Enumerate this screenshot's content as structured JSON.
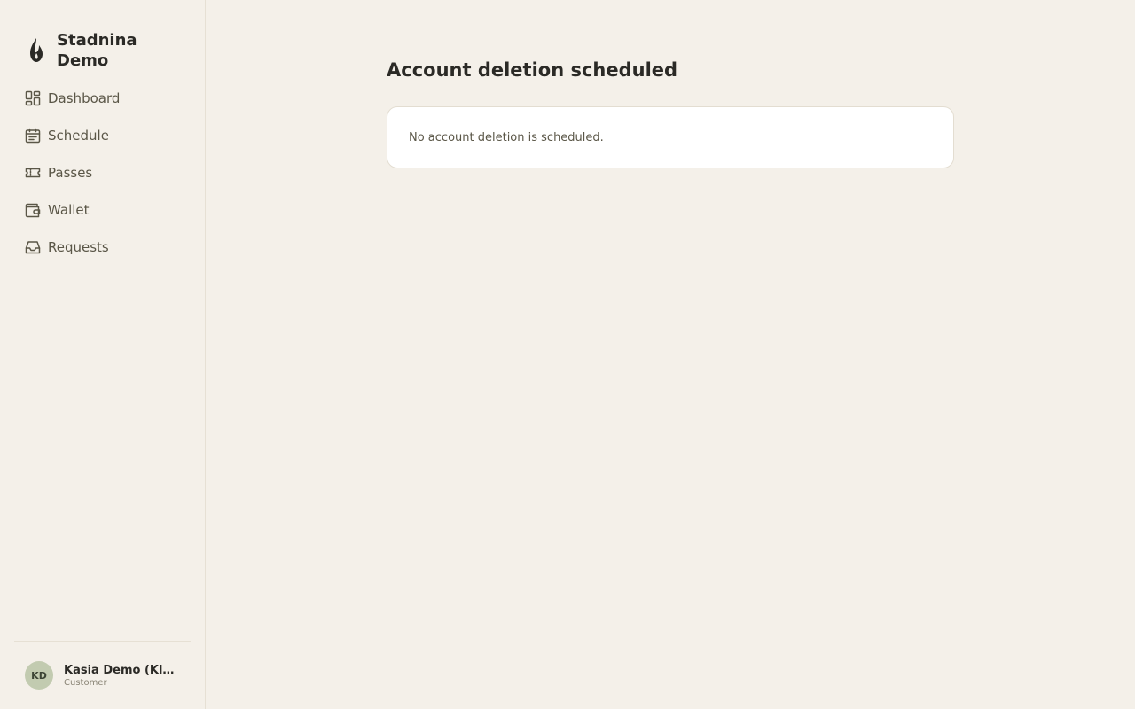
{
  "brand": {
    "name": "Stadnina Demo",
    "logo_icon": "flame-icon"
  },
  "nav": {
    "items": [
      {
        "label": "Dashboard",
        "icon": "grid-icon"
      },
      {
        "label": "Schedule",
        "icon": "calendar-icon"
      },
      {
        "label": "Passes",
        "icon": "ticket-icon"
      },
      {
        "label": "Wallet",
        "icon": "wallet-icon"
      },
      {
        "label": "Requests",
        "icon": "inbox-icon"
      }
    ]
  },
  "user": {
    "initials": "KD",
    "name": "Kasia Demo (Klie...",
    "role": "Customer"
  },
  "main": {
    "title": "Account deletion scheduled",
    "card_text": "No account deletion is scheduled."
  },
  "colors": {
    "background": "#f4f0e9",
    "card": "#ffffff",
    "avatar": "#c2cbb0",
    "text": "#2b2a26",
    "muted": "#5a5647"
  }
}
